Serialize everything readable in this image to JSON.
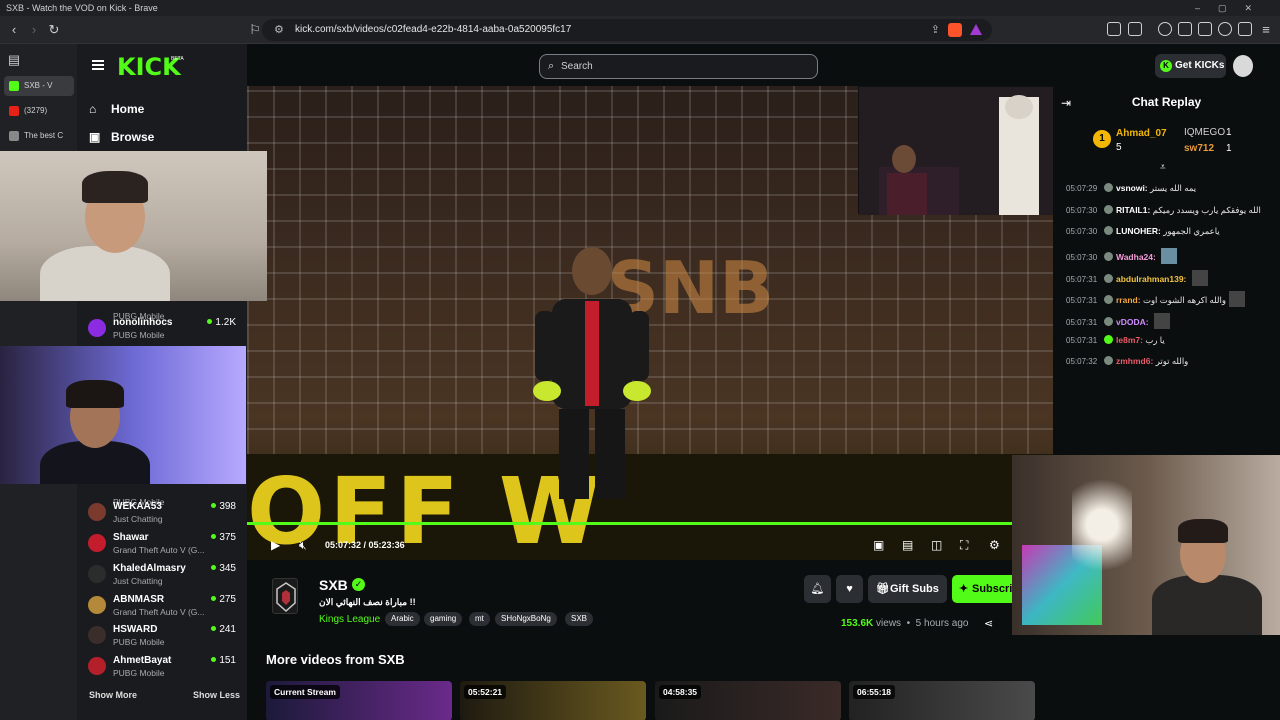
{
  "browser": {
    "window_title": "SXB - Watch the VOD on Kick - Brave",
    "url": "kick.com/sxb/videos/c02fead4-e22b-4814-aaba-0a520095fc17",
    "tabs": [
      {
        "label": "SXB - V",
        "color": "#53fc18"
      },
      {
        "label": "(3279)",
        "color": "#e62117"
      },
      {
        "label": "The best C",
        "color": "#888888"
      }
    ]
  },
  "kick": {
    "logo": "KICK",
    "beta": "BETA",
    "nav": {
      "home": "Home",
      "browse": "Browse"
    },
    "search_placeholder": "Search",
    "get_kicks": "Get KICKs",
    "sidebar_channels": [
      {
        "name": "",
        "game": "PUBG Mobile",
        "viewers": ""
      },
      {
        "name": "nonolinhocs",
        "game": "PUBG Mobile",
        "viewers": "1.2K"
      },
      {
        "name": "",
        "game": "PUBG Mobile",
        "viewers": ""
      },
      {
        "name": "WEKAA53",
        "game": "Just Chatting",
        "viewers": "398"
      },
      {
        "name": "Shawar",
        "game": "Grand Theft Auto V (G...",
        "viewers": "375"
      },
      {
        "name": "KhaledAlmasry",
        "game": "Just Chatting",
        "viewers": "345"
      },
      {
        "name": "ABNMASR",
        "game": "Grand Theft Auto V (G...",
        "viewers": "275"
      },
      {
        "name": "HSWARD",
        "game": "PUBG Mobile",
        "viewers": "241"
      },
      {
        "name": "AhmetBayat",
        "game": "PUBG Mobile",
        "viewers": "151"
      }
    ],
    "show_more": "Show More",
    "show_less": "Show Less"
  },
  "video": {
    "sponsor_text": "SNB",
    "banner_text": "OFF W",
    "current_time": "05:07:32",
    "duration": "05:23:36",
    "progress_fraction": 0.95
  },
  "channel": {
    "name": "SXB",
    "title": "مباراة نصف النهائي الان !!",
    "category": "Kings League",
    "tags": [
      "Arabic",
      "gaming",
      "mt",
      "SHoNgxBoNg",
      "SXB"
    ],
    "gift_subs": "Gift Subs",
    "subscribe": "Subscri",
    "views": "153.6K",
    "views_label": "views",
    "age": "5 hours ago"
  },
  "more_videos": {
    "title": "More videos from SXB",
    "items": [
      {
        "label": "Current Stream"
      },
      {
        "label": "05:52:21"
      },
      {
        "label": "04:58:35"
      },
      {
        "label": "06:55:18"
      }
    ]
  },
  "chat": {
    "title": "Chat Replay",
    "leaders": [
      {
        "name": "Ahmad_07",
        "count": "5",
        "color": "#f2b705"
      },
      {
        "name": "IQMEGO",
        "count": "1",
        "color": "#cfd0d2"
      },
      {
        "name": "sw712",
        "count": "1",
        "color": "#e89a3c"
      }
    ],
    "messages": [
      {
        "time": "05:07:29",
        "user": "vsnowi:",
        "text": "يمه الله يستر",
        "color": "#ffffff"
      },
      {
        "time": "05:07:30",
        "user": "RITAIL1:",
        "text": "الله يوفقكم يارب ويسدد رميكم",
        "color": "#ffffff"
      },
      {
        "time": "05:07:30",
        "user": "LUNOHER:",
        "text": "ياعمري الجمهور",
        "color": "#ffffff"
      },
      {
        "time": "05:07:30",
        "user": "Wadha24:",
        "text": "",
        "color": "#f59ad7"
      },
      {
        "time": "05:07:31",
        "user": "abdulrahman139:",
        "text": "",
        "color": "#f5c542"
      },
      {
        "time": "05:07:31",
        "user": "rrand:",
        "text": "والله اكرهه الشوت اوت",
        "color": "#f5a742"
      },
      {
        "time": "05:07:31",
        "user": "vDODA:",
        "text": "",
        "color": "#d18cff"
      },
      {
        "time": "05:07:31",
        "user": "le8m7:",
        "text": "يا رب",
        "color": "#e85c6a"
      },
      {
        "time": "05:07:32",
        "user": "zmhmd6:",
        "text": "والله توتر",
        "color": "#e85c6a"
      }
    ]
  }
}
